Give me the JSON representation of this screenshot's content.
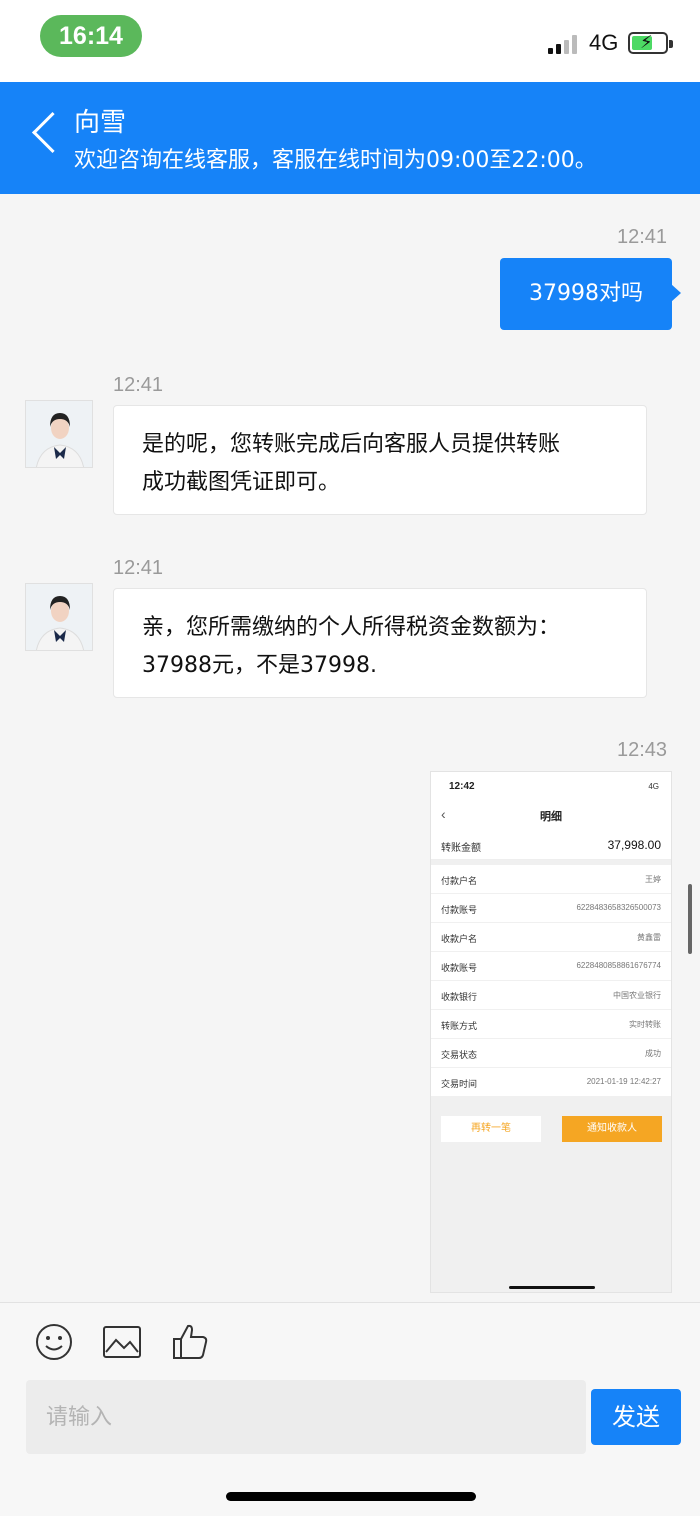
{
  "status_bar": {
    "time": "16:14",
    "network": "4G"
  },
  "header": {
    "title": "向雪",
    "subtitle": "欢迎咨询在线客服，客服在线时间为09:00至22:00。"
  },
  "messages": [
    {
      "time": "12:41",
      "side": "out",
      "text": "37998对吗"
    },
    {
      "time": "12:41",
      "side": "in",
      "lines": [
        "是的呢，您转账完成后向客服人员提供转账",
        "成功截图凭证即可。"
      ]
    },
    {
      "time": "12:41",
      "side": "in",
      "lines": [
        "亲，您所需缴纳的个人所得税资金数额为：",
        "37988元，不是37998."
      ]
    },
    {
      "time": "12:43",
      "side": "out",
      "type": "image"
    }
  ],
  "screenshot": {
    "time": "12:42",
    "network": "4G",
    "title": "明细",
    "amount_label": "转账金额",
    "amount_value": "37,998.00",
    "rows": [
      {
        "label": "付款户名",
        "value": "王婷"
      },
      {
        "label": "付款账号",
        "value": "6228483658326500073"
      },
      {
        "label": "收款户名",
        "value": "黄鑫雷"
      },
      {
        "label": "收款账号",
        "value": "6228480858861676774"
      },
      {
        "label": "收款银行",
        "value": "中国农业银行"
      },
      {
        "label": "转账方式",
        "value": "实时转账"
      },
      {
        "label": "交易状态",
        "value": "成功"
      },
      {
        "label": "交易时间",
        "value": "2021-01-19 12:42:27"
      }
    ],
    "button_again": "再转一笔",
    "button_notify": "通知收款人"
  },
  "input": {
    "placeholder": "请输入"
  },
  "send_label": "发送",
  "colors": {
    "brand_blue": "#1683f8",
    "status_green": "#5bb85b",
    "orange": "#f5a623"
  }
}
